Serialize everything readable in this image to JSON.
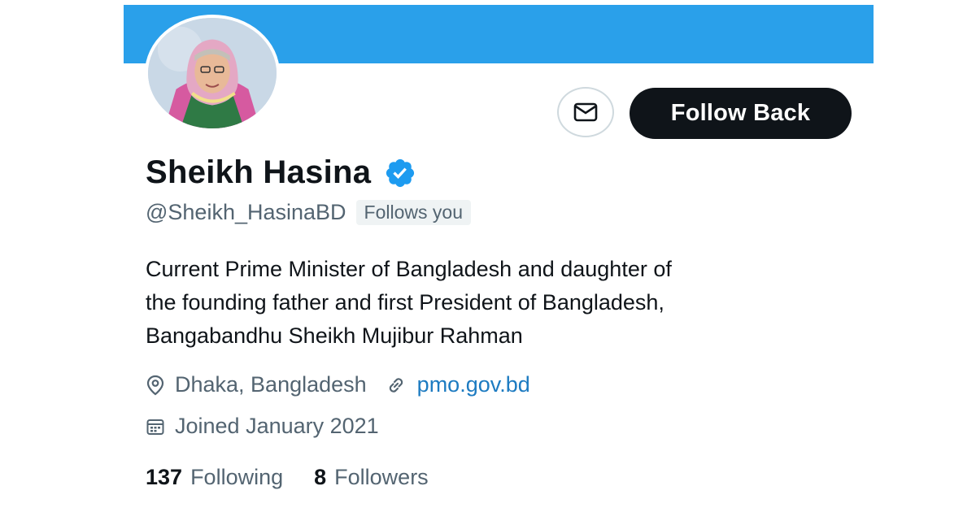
{
  "profile": {
    "name": "Sheikh Hasina",
    "handle": "@Sheikh_HasinaBD",
    "follows_you": "Follows you",
    "bio_lines": [
      "Current Prime Minister of Bangladesh and daughter of",
      "the founding father and first President of Bangladesh,",
      "Bangabandhu Sheikh Mujibur Rahman"
    ],
    "location": "Dhaka, Bangladesh",
    "website": "pmo.gov.bd",
    "joined": "Joined January 2021",
    "following_count": "137",
    "following_label": "Following",
    "followers_count": "8",
    "followers_label": "Followers",
    "verified": true
  },
  "actions": {
    "message_icon": "mail-icon",
    "follow_label": "Follow Back"
  },
  "icons": {
    "verified": "verified-badge-icon",
    "location": "location-pin-icon",
    "link": "link-icon",
    "calendar": "calendar-icon"
  },
  "colors": {
    "banner": "#2aa0ea",
    "verified": "#1d9bf0",
    "link": "#1d7bc1",
    "button_bg": "#0f1419",
    "muted_text": "#536471"
  }
}
